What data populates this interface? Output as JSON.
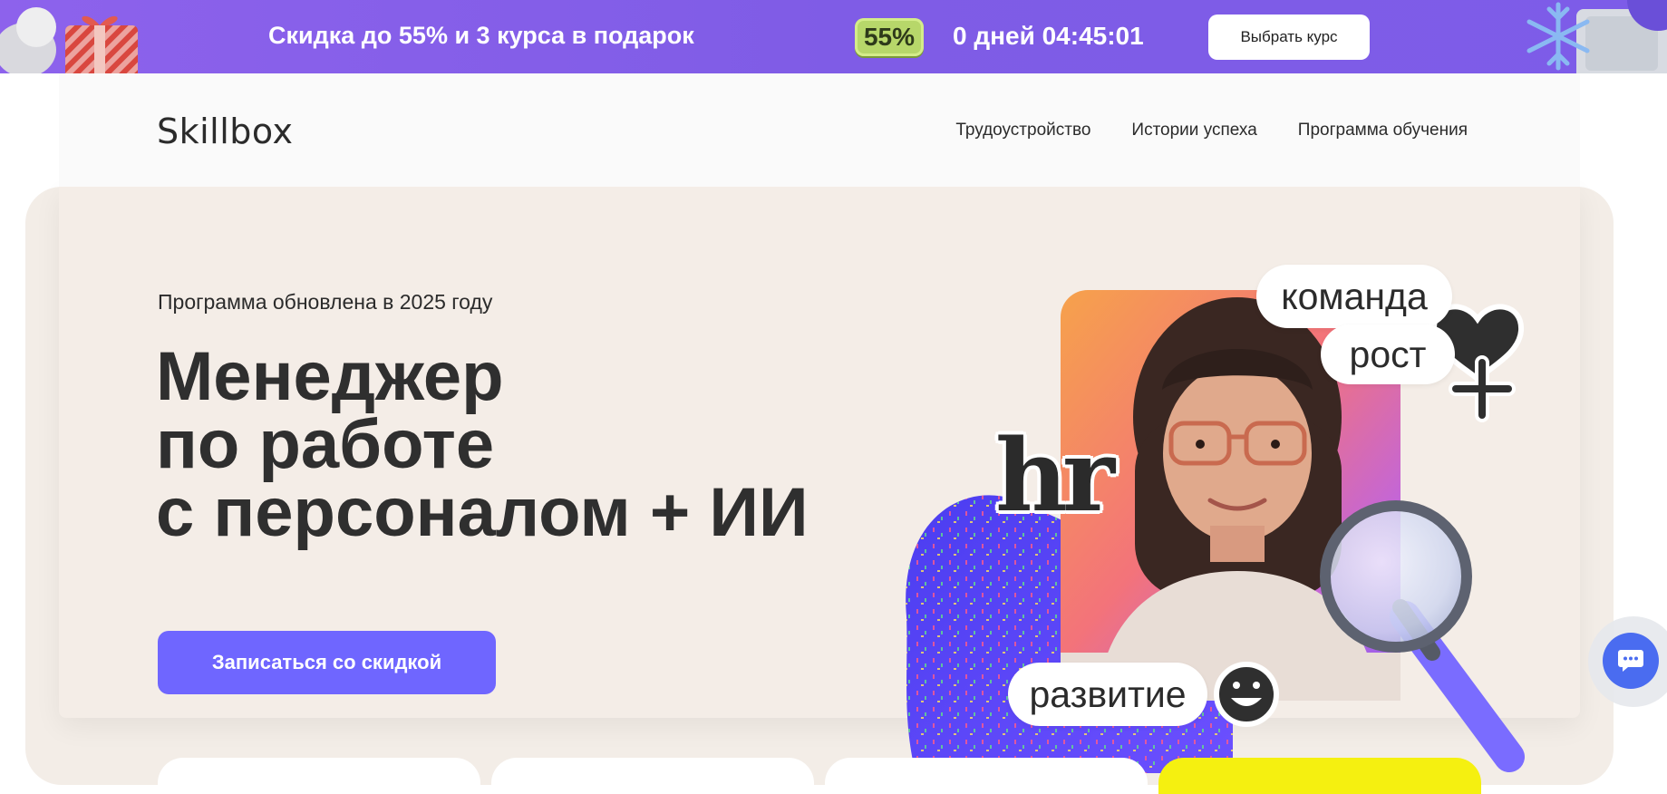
{
  "promo": {
    "text": "Скидка до 55% и 3 курса в подарок",
    "badge": "55%",
    "timer": "0 дней 04:45:01",
    "button_label": "Выбрать курс"
  },
  "header": {
    "logo": "Skillbox",
    "nav": [
      {
        "label": "Трудоустройство"
      },
      {
        "label": "Истории успеха"
      },
      {
        "label": "Программа обучения"
      }
    ]
  },
  "hero": {
    "subtitle": "Программа обновлена в 2025 году",
    "title_lines": [
      "Менеджер",
      "по работе",
      "с персоналом + ИИ"
    ],
    "cta_label": "Записаться со скидкой"
  },
  "illustration": {
    "pills": {
      "team": "команда",
      "growth": "рост",
      "development": "развитие"
    },
    "hr_word": "hr",
    "icons": [
      "heart-icon",
      "plus-icon",
      "smiley-icon",
      "magnifier-icon"
    ]
  },
  "colors": {
    "promo_bg": "#8360ea",
    "badge_bg": "#b7d76a",
    "cta_bg": "#6f66ff",
    "hero_bg": "#f3ede7",
    "chat_bg": "#4a6cf0",
    "yellow_card": "#f5f010"
  }
}
